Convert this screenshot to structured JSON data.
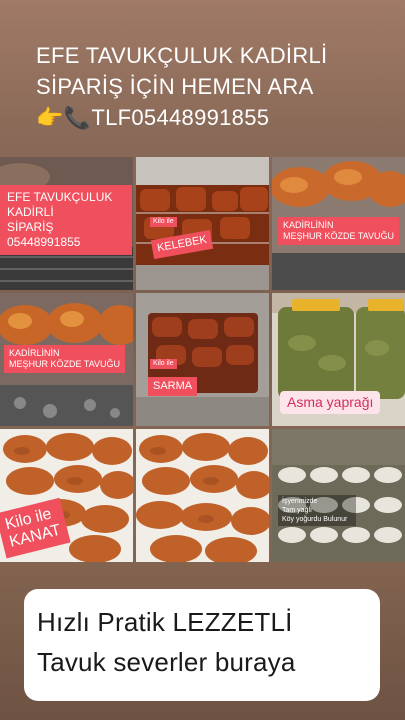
{
  "header": {
    "line1": "EFE TAVUKÇULUK KADİRLİ",
    "line2": "SİPARİŞ İÇİN HEMEN ARA",
    "line3": "👉📞TLF05448991855"
  },
  "tiles": {
    "t1": {
      "label": "EFE TAVUKÇULUK\nKADİRLİ\nSİPARİŞ\n 05448991855"
    },
    "t2": {
      "label": "KELEBEK",
      "small": "Kilo ile"
    },
    "t3": {
      "label": "KADİRLİNİN\nMEŞHUR KÖZDE TAVUĞU"
    },
    "t4": {
      "label": "KADİRLİNİN\nMEŞHUR KÖZDE TAVUĞU"
    },
    "t5": {
      "label": "SARMA",
      "small": "Kilo ile"
    },
    "t6": {
      "label": "Asma yaprağı"
    },
    "t7": {
      "label": "Kilo ile\nKANAT"
    },
    "t9": {
      "label": "İşyerimizde\nTam yağlı\nKöy yoğurdu Bulunur"
    }
  },
  "footer": {
    "line1": "Hızlı Pratik LEZZETLİ",
    "line2": "Tavuk severler buraya"
  },
  "colors": {
    "accent_label": "#f0505d",
    "pink_label": "#fde4ea",
    "footer_bg": "#ffffff"
  }
}
